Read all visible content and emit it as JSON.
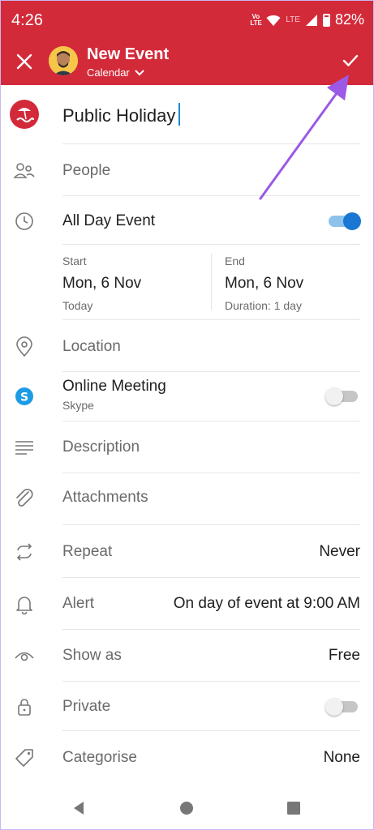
{
  "status": {
    "time": "4:26",
    "volte": "Vo LTE",
    "lte": "LTE",
    "battery": "82%"
  },
  "header": {
    "title": "New Event",
    "calendar": "Calendar",
    "accent": "#d32a3a"
  },
  "event": {
    "title": "Public Holiday"
  },
  "rows": {
    "people": "People",
    "all_day": "All Day Event",
    "start_label": "Start",
    "start_date": "Mon, 6 Nov",
    "start_note": "Today",
    "end_label": "End",
    "end_date": "Mon, 6 Nov",
    "end_note": "Duration: 1 day",
    "location": "Location",
    "online_meeting": "Online Meeting",
    "online_provider": "Skype",
    "description": "Description",
    "attachments": "Attachments",
    "repeat": "Repeat",
    "repeat_value": "Never",
    "alert": "Alert",
    "alert_value": "On day of event at 9:00 AM",
    "show_as": "Show as",
    "show_as_value": "Free",
    "private": "Private",
    "categorise": "Categorise",
    "categorise_value": "None"
  },
  "toggles": {
    "all_day": true,
    "online_meeting": false,
    "private": false
  },
  "icons": [
    "close-icon",
    "check-icon",
    "chevron-down-icon",
    "holiday-icon",
    "people-icon",
    "clock-icon",
    "location-icon",
    "skype-icon",
    "description-icon",
    "attachment-icon",
    "repeat-icon",
    "bell-icon",
    "eye-icon",
    "lock-icon",
    "tag-icon",
    "back-icon",
    "home-icon",
    "recents-icon"
  ],
  "annotation_color": "#9b59e6"
}
